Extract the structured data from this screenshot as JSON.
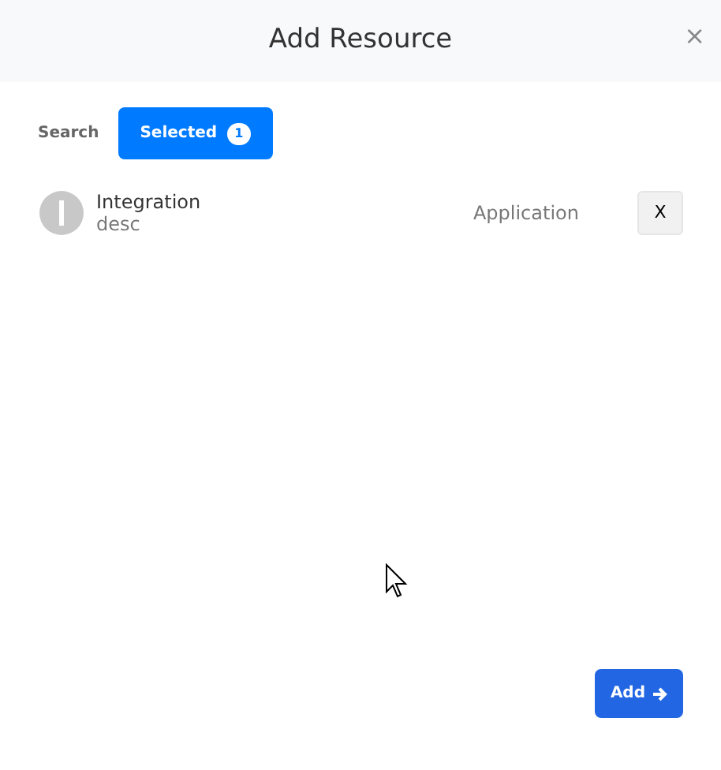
{
  "modal": {
    "title": "Add Resource",
    "close": "×"
  },
  "tabs": [
    {
      "label": "Search",
      "selected": false
    },
    {
      "label": "Selected",
      "selected": true,
      "count": "1"
    }
  ],
  "items": [
    {
      "name": "Integration",
      "description": "desc",
      "type": "Application",
      "remove": "X"
    }
  ],
  "footer": {
    "button": "Add"
  }
}
